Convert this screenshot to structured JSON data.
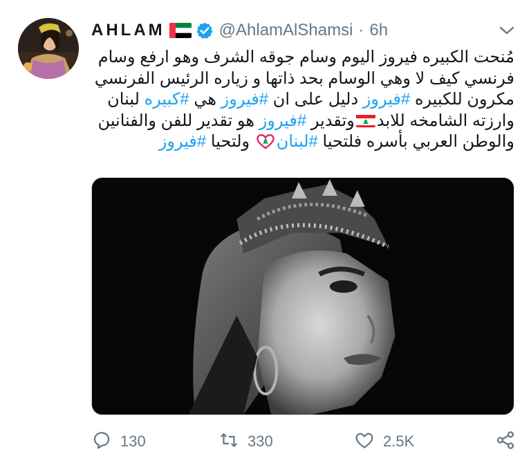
{
  "tweet": {
    "display_name": "AHLAM",
    "handle": "@AhlamAlShamsi",
    "separator": "·",
    "time": "6h",
    "icons": {
      "name_flag": "uae-flag-icon",
      "verified": "verified-badge-icon",
      "menu": "chevron-down-icon",
      "avatar": "avatar-photo"
    },
    "body": {
      "l1": "مُنحت الكبيره فيروز اليوم وسام جوقه الشرف وهو ارفع وسام",
      "l2": "فرنسي كيف لا وهي الوسام بحد ذاتها و زياره الرئيس الفرنسي",
      "l3a": "مكرون للكبيره ",
      "l3b": "#فيروز",
      "l3c": " دليل على ان ",
      "l3d": "#فيروز",
      "l3e": " هي ",
      "l3f": "#كبيره",
      "l3g": " لبنان",
      "l4a": "وارزته الشامخه للابد",
      "l4b": "وتقدير ",
      "l4c": "#فيروز",
      "l4d": " هو تقدير للفن والفنانين",
      "l5a": "والوطن العربي بأسره فلتحيا ",
      "l5b": "#لبنان",
      "l5c": " ولتحيا ",
      "l5d": "#فيروز"
    },
    "media": {
      "description_icon": "black-and-white-portrait-photo"
    },
    "actions": {
      "reply_count": "130",
      "retweet_count": "330",
      "like_count": "2.5K"
    },
    "colors": {
      "link": "#1da1f2",
      "muted": "#657786",
      "text": "#14171a",
      "verified": "#1da1f2"
    }
  }
}
